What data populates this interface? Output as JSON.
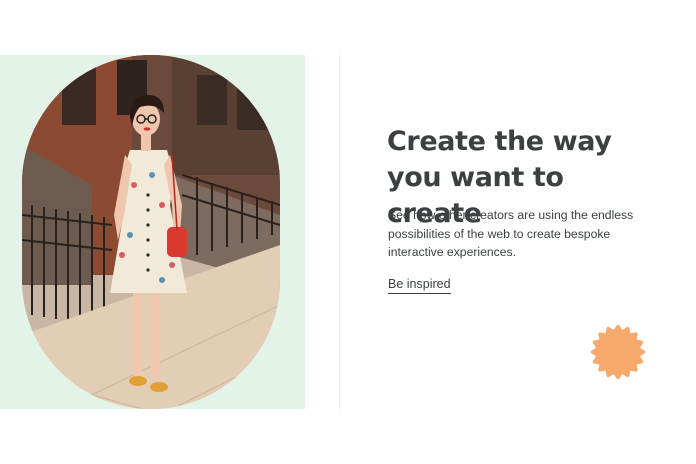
{
  "hero": {
    "headline": "Create the way you want to create",
    "description": "See how other creators are using the endless possibilities of the web to create bespoke interactive experiences.",
    "link_label": "Be inspired"
  },
  "colors": {
    "panel_background": "#e3f3e8",
    "text": "#3c4043",
    "badge": "#f7a86b"
  },
  "icons": {
    "badge": "scalloped-circle-icon"
  }
}
